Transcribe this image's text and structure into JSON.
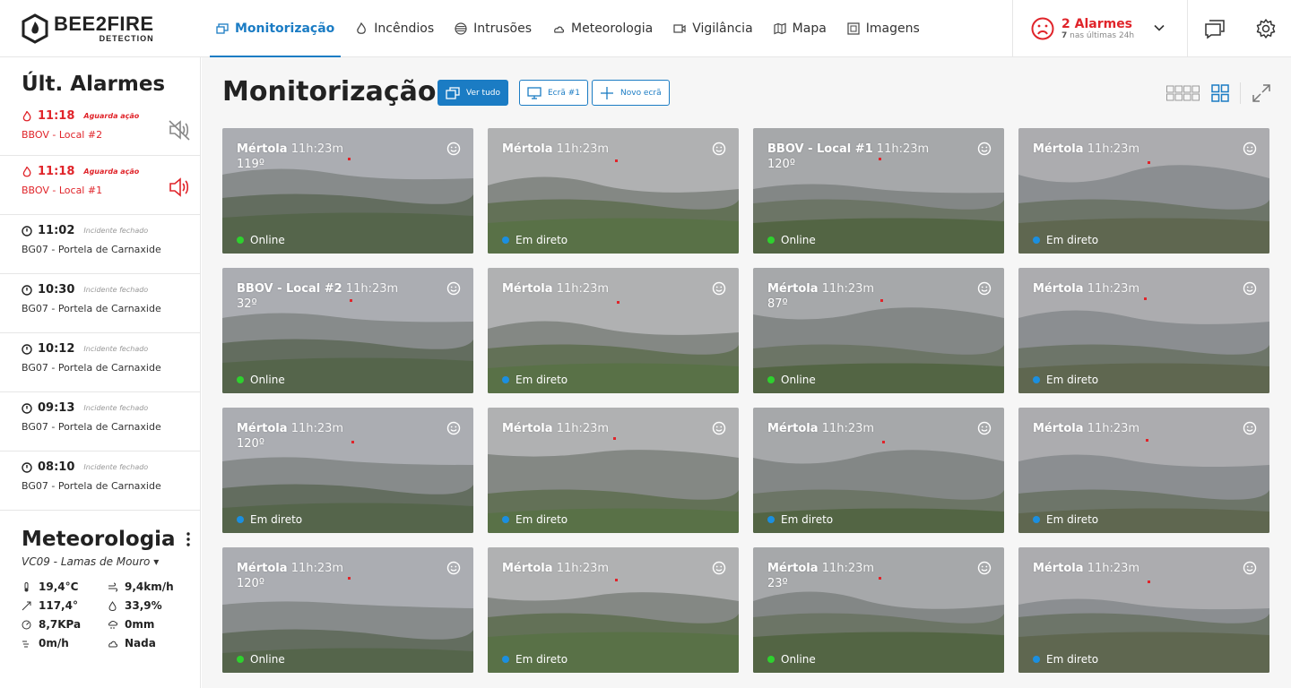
{
  "brand": {
    "word": "BEE2FIRE",
    "sub": "DETECTION"
  },
  "nav": [
    {
      "label": "Monitorização",
      "icon": "monitor-icon",
      "active": true
    },
    {
      "label": "Incêndios",
      "icon": "fire-icon"
    },
    {
      "label": "Intrusões",
      "icon": "intrusion-icon"
    },
    {
      "label": "Meteorologia",
      "icon": "weather-icon"
    },
    {
      "label": "Vigilância",
      "icon": "camera-icon"
    },
    {
      "label": "Mapa",
      "icon": "map-icon"
    },
    {
      "label": "Imagens",
      "icon": "images-icon"
    }
  ],
  "alarms": {
    "title": "2 Alarmes",
    "count": "7",
    "sub": "nas últimas 24h",
    "color": "#e0242a"
  },
  "sidebar": {
    "title": "Últ. Alarmes",
    "items": [
      {
        "time": "11:18",
        "status": "Aguarda ação",
        "location": "BBOV - Local #2",
        "alert": true,
        "sound": "speaker-muted-icon"
      },
      {
        "time": "11:18",
        "status": "Aguarda ação",
        "location": "BBOV - Local #1",
        "alert": true,
        "sound": "speaker-on-icon"
      },
      {
        "time": "11:02",
        "status": "Incidente fechado",
        "location": "BG07 - Portela de Carnaxide"
      },
      {
        "time": "10:30",
        "status": "Incidente fechado",
        "location": "BG07 - Portela de Carnaxide"
      },
      {
        "time": "10:12",
        "status": "Incidente fechado",
        "location": "BG07 - Portela de Carnaxide"
      },
      {
        "time": "09:13",
        "status": "Incidente fechado",
        "location": "BG07 - Portela de Carnaxide"
      },
      {
        "time": "08:10",
        "status": "Incidente fechado",
        "location": "BG07 - Portela de Carnaxide"
      }
    ]
  },
  "meteo": {
    "title": "Meteorologia",
    "station": "VC09 - Lamas de Mouro",
    "readings": [
      {
        "icon": "thermometer-icon",
        "value": "19,4°C"
      },
      {
        "icon": "wind-icon",
        "value": "9,4km/h"
      },
      {
        "icon": "wind-direction-icon",
        "value": "117,4°"
      },
      {
        "icon": "humidity-icon",
        "value": "33,9%"
      },
      {
        "icon": "pressure-icon",
        "value": "8,7KPa"
      },
      {
        "icon": "rain-icon",
        "value": "0mm"
      },
      {
        "icon": "gust-icon",
        "value": "0m/h"
      },
      {
        "icon": "cloud-icon",
        "value": "Nada"
      }
    ]
  },
  "main": {
    "title": "Monitorização",
    "buttons": {
      "view_all": "Ver tudo",
      "screen1": "Ecrã #1",
      "new_screen": "Novo ecrã"
    }
  },
  "status_colors": {
    "Online": "#2ed12e",
    "Em direto": "#1b8fe0"
  },
  "cameras": [
    {
      "name": "Mértola",
      "duration": "11h:23m",
      "degree": "119º",
      "status": "Online"
    },
    {
      "name": "Mértola",
      "duration": "11h:23m",
      "degree": "",
      "status": "Em direto"
    },
    {
      "name": "BBOV - Local #1",
      "duration": "11h:23m",
      "degree": "120º",
      "status": "Online"
    },
    {
      "name": "Mértola",
      "duration": "11h:23m",
      "degree": "",
      "status": "Em direto"
    },
    {
      "name": "BBOV - Local #2",
      "duration": "11h:23m",
      "degree": "32º",
      "status": "Online"
    },
    {
      "name": "Mértola",
      "duration": "11h:23m",
      "degree": "",
      "status": "Em direto"
    },
    {
      "name": "Mértola",
      "duration": "11h:23m",
      "degree": "87º",
      "status": "Online"
    },
    {
      "name": "Mértola",
      "duration": "11h:23m",
      "degree": "",
      "status": "Em direto"
    },
    {
      "name": "Mértola",
      "duration": "11h:23m",
      "degree": "120º",
      "status": "Em direto"
    },
    {
      "name": "Mértola",
      "duration": "11h:23m",
      "degree": "",
      "status": "Em direto"
    },
    {
      "name": "Mértola",
      "duration": "11h:23m",
      "degree": "",
      "status": "Em direto"
    },
    {
      "name": "Mértola",
      "duration": "11h:23m",
      "degree": "",
      "status": "Em direto"
    },
    {
      "name": "Mértola",
      "duration": "11h:23m",
      "degree": "120º",
      "status": "Online"
    },
    {
      "name": "Mértola",
      "duration": "11h:23m",
      "degree": "",
      "status": "Em direto"
    },
    {
      "name": "Mértola",
      "duration": "11h:23m",
      "degree": "23º",
      "status": "Online"
    },
    {
      "name": "Mértola",
      "duration": "11h:23m",
      "degree": "",
      "status": "Em direto"
    }
  ]
}
